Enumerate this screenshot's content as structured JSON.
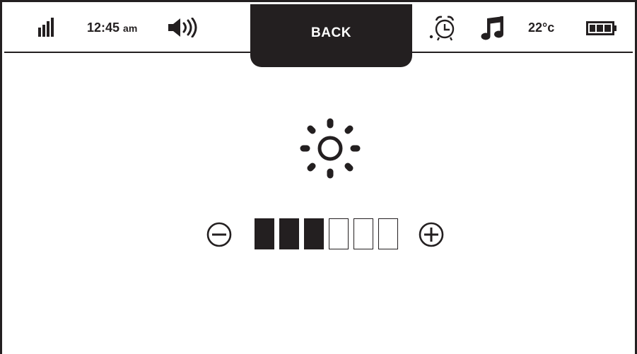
{
  "status_bar": {
    "signal_icon": "signal-bars-icon",
    "time": "12:45",
    "time_suffix": "am",
    "volume_icon": "speaker-volume-icon",
    "back_label": "BACK",
    "alarm_icon": "alarm-clock-icon",
    "music_icon": "music-note-icon",
    "temperature": "22°c",
    "battery_icon": "battery-icon"
  },
  "brightness": {
    "icon": "sun-brightness-icon",
    "decrease_icon": "minus-circle-icon",
    "increase_icon": "plus-circle-icon",
    "level": 3,
    "max_level": 6
  },
  "colors": {
    "ink": "#231f20",
    "background": "#ffffff"
  }
}
